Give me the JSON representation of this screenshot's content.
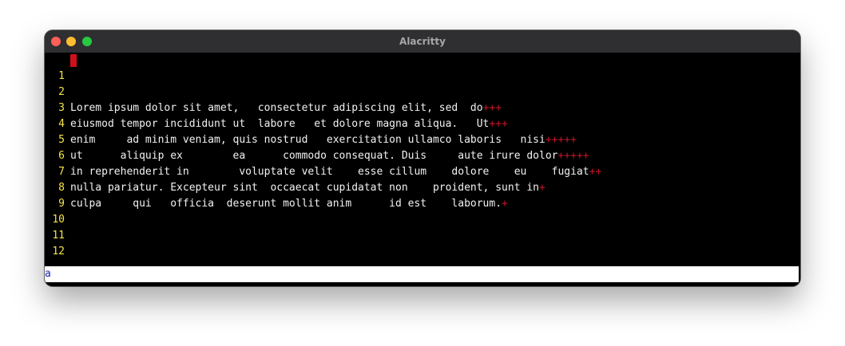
{
  "window": {
    "title": "Alacritty"
  },
  "editor": {
    "lines": [
      {
        "num": "1",
        "text": "",
        "trail": ""
      },
      {
        "num": "2",
        "text": "Lorem ipsum dolor sit amet,   consectetur adipiscing elit, sed  do",
        "trail": "+++"
      },
      {
        "num": "3",
        "text": "eiusmod tempor incididunt ut  labore   et dolore magna aliqua.   Ut",
        "trail": "+++"
      },
      {
        "num": "4",
        "text": "enim     ad minim veniam, quis nostrud   exercitation ullamco laboris   nisi",
        "trail": "+++++"
      },
      {
        "num": "5",
        "text": "ut      aliquip ex        ea      commodo consequat. Duis     aute irure dolor",
        "trail": "+++++"
      },
      {
        "num": "6",
        "text": "in reprehenderit in        voluptate velit    esse cillum    dolore    eu    fugiat",
        "trail": "++"
      },
      {
        "num": "7",
        "text": "nulla pariatur. Excepteur sint  occaecat cupidatat non    proident, sunt in",
        "trail": "+"
      },
      {
        "num": "8",
        "text": "culpa     qui   officia  deserunt mollit anim      id est    laborum.",
        "trail": "+"
      },
      {
        "num": "9",
        "text": "",
        "trail": ""
      },
      {
        "num": "10",
        "text": "",
        "trail": ""
      },
      {
        "num": "11",
        "text": "",
        "trail": ""
      },
      {
        "num": "12",
        "text": "",
        "trail": ""
      }
    ],
    "command_line": "a"
  },
  "colors": {
    "line_number": "#f3e34b",
    "text": "#f2f2f2",
    "trailing_marker": "#c5152a",
    "cursor": "#d0101c",
    "command_text": "#1624b6"
  }
}
